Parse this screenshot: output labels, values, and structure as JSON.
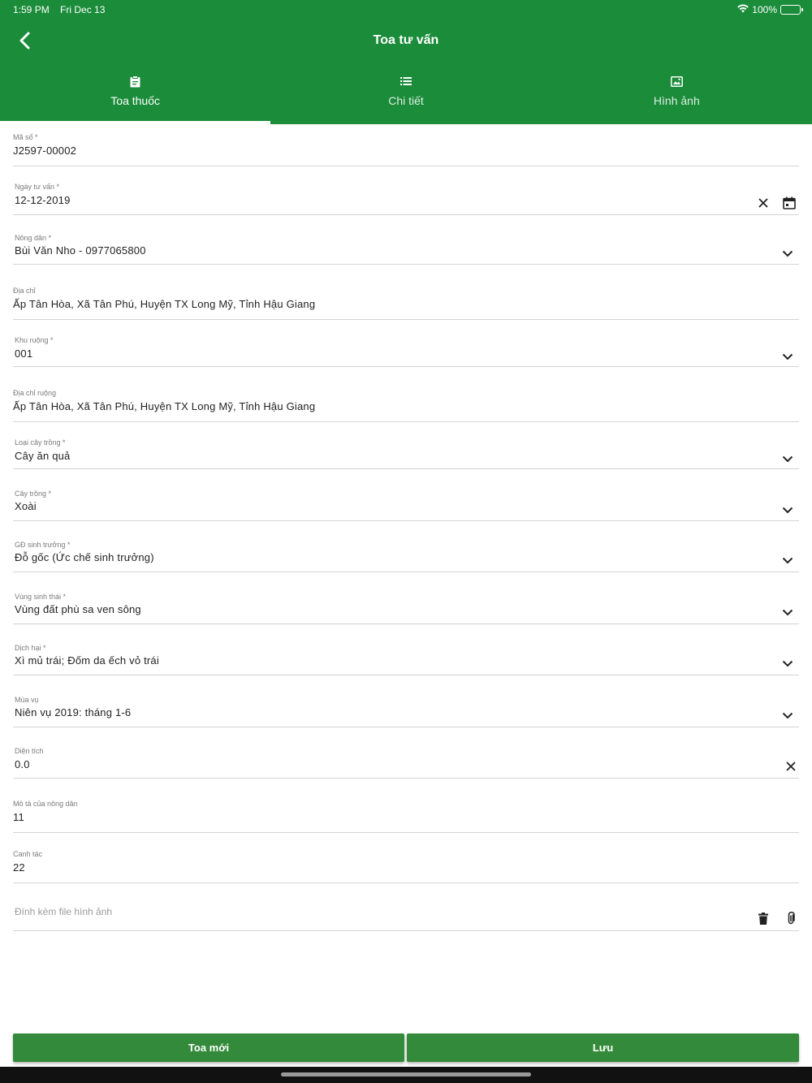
{
  "status_bar": {
    "time": "1:59 PM",
    "date": "Fri Dec 13",
    "battery": "100%"
  },
  "header": {
    "title": "Toa tư vấn"
  },
  "tabs": [
    {
      "label": "Toa thuốc",
      "icon": "clipboard-icon",
      "active": true
    },
    {
      "label": "Chi tiết",
      "icon": "list-icon",
      "active": false
    },
    {
      "label": "Hình ảnh",
      "icon": "image-icon",
      "active": false
    }
  ],
  "form": {
    "ma_so": {
      "label": "Mã số *",
      "value": "J2597-00002"
    },
    "ngay_tu_van": {
      "label": "Ngày tư vấn *",
      "value": "12-12-2019"
    },
    "nong_dan": {
      "label": "Nông dân *",
      "value": "Bùi Văn Nho - 0977065800"
    },
    "dia_chi": {
      "label": "Địa chỉ",
      "value": "Ấp Tân Hòa, Xã  Tân Phú, Huyện TX Long Mỹ, Tỉnh  Hậu Giang"
    },
    "khu_ruong": {
      "label": "Khu ruộng *",
      "value": "001"
    },
    "dia_chi_ruong": {
      "label": "Địa chỉ ruộng",
      "value": "Ấp Tân Hòa, Xã  Tân Phú, Huyện TX Long Mỹ, Tỉnh  Hậu Giang"
    },
    "loai_cay_trong": {
      "label": "Loại cây trồng *",
      "value": "Cây ăn quả"
    },
    "cay_trong": {
      "label": "Cây trồng *",
      "value": "Xoài"
    },
    "gd_sinh_truong": {
      "label": "GĐ sinh trưởng *",
      "value": "Đỗ gốc (Ức chế sinh trưởng)"
    },
    "vung_sinh_thai": {
      "label": "Vùng sinh thái *",
      "value": "Vùng đất phù sa ven sông"
    },
    "dich_hai": {
      "label": "Dịch hại *",
      "value": "Xì mủ trái; Đốm da ếch vỏ trái"
    },
    "mua_vu": {
      "label": "Mùa vụ",
      "value": "Niên vụ 2019: tháng 1-6"
    },
    "dien_tich": {
      "label": "Diện tích",
      "value": "0.0"
    },
    "mo_ta": {
      "label": "Mô tả của nông dân",
      "value": "11"
    },
    "canh_tac": {
      "label": "Canh tác",
      "value": "22"
    },
    "dinh_kem": {
      "placeholder": "Đính kèm file hình ảnh"
    }
  },
  "buttons": {
    "new_label": "Toa mới",
    "save_label": "Lưu"
  },
  "colors": {
    "primary": "#1a8c3a",
    "button": "#338a3a"
  }
}
